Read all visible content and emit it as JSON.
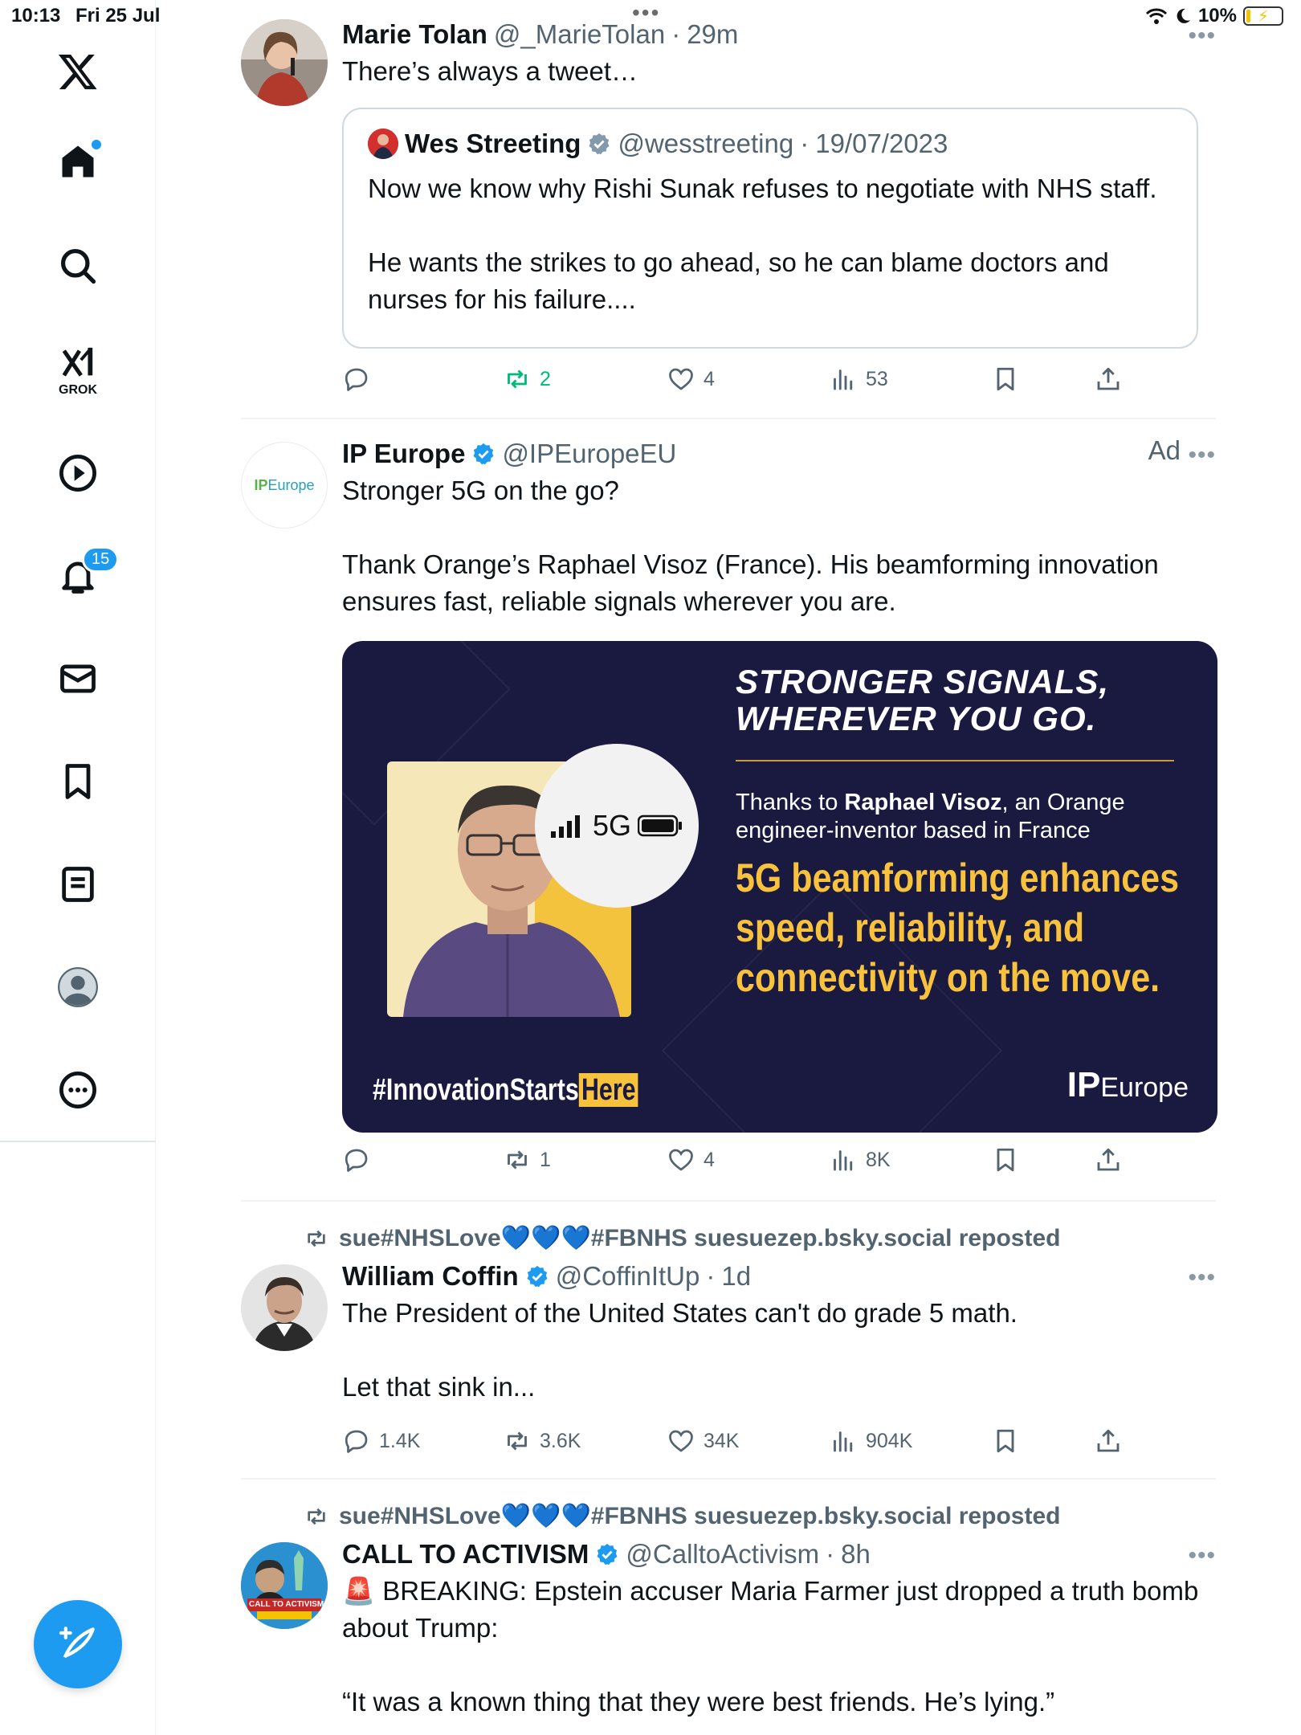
{
  "status_bar": {
    "time": "10:13",
    "date": "Fri 25 Jul",
    "battery": "10%",
    "dots": "•••"
  },
  "sidebar": {
    "items": [
      {
        "name": "x-logo",
        "icon": "x-logo-icon"
      },
      {
        "name": "home",
        "icon": "home-icon"
      },
      {
        "name": "search",
        "icon": "search-icon"
      },
      {
        "name": "grok",
        "icon": "grok-icon",
        "label": "GROK"
      },
      {
        "name": "video",
        "icon": "play-icon"
      },
      {
        "name": "notifications",
        "icon": "bell-icon",
        "badge": "15"
      },
      {
        "name": "messages",
        "icon": "mail-icon"
      },
      {
        "name": "bookmarks",
        "icon": "bookmark-icon"
      },
      {
        "name": "articles",
        "icon": "article-icon"
      },
      {
        "name": "profile",
        "icon": "profile-icon"
      },
      {
        "name": "more",
        "icon": "more-icon"
      }
    ],
    "compose_icon": "compose-icon"
  },
  "tweets": [
    {
      "name": "Marie Tolan",
      "handle": "@_MarieTolan",
      "sep": "·",
      "time": "29m",
      "text": "There’s always a tweet…",
      "quote": {
        "name": "Wes Streeting",
        "handle": "@wesstreeting",
        "sep": "·",
        "time": "19/07/2023",
        "text": "Now we know why Rishi Sunak refuses to negotiate with NHS staff.\n\nHe wants the strikes to go ahead, so he can blame doctors and nurses for his failure...."
      },
      "actions": {
        "replies": "",
        "reposts": "2",
        "likes": "4",
        "views": "53"
      }
    },
    {
      "name": "IP Europe",
      "handle": "@IPEuropeEU",
      "ad_label": "Ad",
      "avatar_text_a": "IP",
      "avatar_text_b": "Europe",
      "text": "Stronger 5G on the go?\n\nThank Orange’s Raphael Visoz (France). His beamforming innovation ensures fast, reliable signals wherever you are.",
      "image": {
        "headline_1": "STRONGER SIGNALS,",
        "headline_2": "WHEREVER YOU GO.",
        "thanks_pre": "Thanks to ",
        "thanks_name": "Raphael Visoz",
        "thanks_post": ", an Orange engineer-inventor based in France",
        "big_1": "5G beamforming enhances",
        "big_2": "speed, reliability, and",
        "big_3": "connectivity on the move.",
        "bubble": "5G",
        "hashtag_a": "#InnovationStarts",
        "hashtag_b": "Here",
        "logo_a": "IP",
        "logo_b": "Europe"
      },
      "actions": {
        "replies": "",
        "reposts": "1",
        "likes": "4",
        "views": "8K"
      }
    },
    {
      "repost_by": "sue#NHSLove💙💙💙#FBNHS suesuezep.bsky.social reposted",
      "name": "William Coffin",
      "handle": "@CoffinItUp",
      "sep": "·",
      "time": "1d",
      "text": "The President of the United States can't do grade 5 math.\n\nLet that sink in...",
      "actions": {
        "replies": "1.4K",
        "reposts": "3.6K",
        "likes": "34K",
        "views": "904K"
      }
    },
    {
      "repost_by": "sue#NHSLove💙💙💙#FBNHS suesuezep.bsky.social reposted",
      "name": "CALL TO ACTIVISM",
      "handle": "@CalltoActivism",
      "sep": "·",
      "time": "8h",
      "avatar_text": "CALL TO ACTIVISM",
      "text": "🚨 BREAKING: Epstein accuser Maria Farmer just dropped a truth bomb about Trump:\n\n“It was a known thing that they were best friends. He’s lying.”"
    }
  ],
  "more_label": "•••",
  "colors": {
    "accent": "#1d9bf0",
    "repost_green": "#00ba7c",
    "muted": "#536471",
    "ad_bg": "#1a1a40",
    "ad_yellow": "#f8c23c"
  }
}
